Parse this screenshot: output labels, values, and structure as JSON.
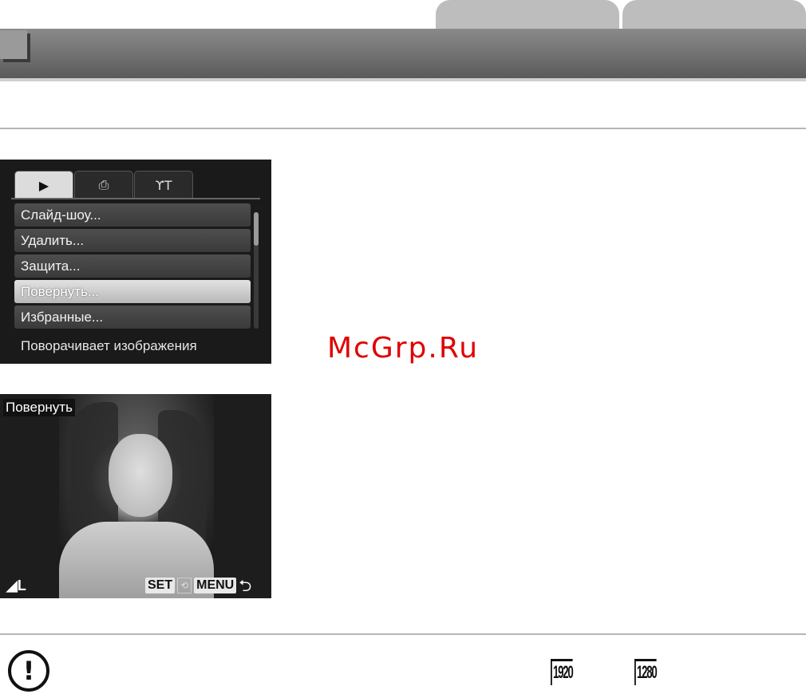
{
  "menu_screen": {
    "tabs": [
      {
        "icon": "play-icon",
        "glyph": "▶"
      },
      {
        "icon": "print-icon",
        "glyph": "⎙"
      },
      {
        "icon": "tools-icon",
        "glyph": "ϒT"
      }
    ],
    "items": [
      "Слайд-шоу...",
      "Удалить...",
      "Защита...",
      "Повернуть...",
      "Избранные..."
    ],
    "selected_index": 3,
    "status_text": "Поворачивает изображения"
  },
  "watermark": "McGrp.Ru",
  "rotate_screen": {
    "label": "Повернуть",
    "size_indicator": "◢L",
    "set_key": "SET",
    "rotate_glyph": "⟲",
    "menu_key": "MENU",
    "back_glyph": "⮌"
  },
  "footer": {
    "warning_glyph": "!",
    "resolution_icons": [
      "1920",
      "1280"
    ]
  }
}
